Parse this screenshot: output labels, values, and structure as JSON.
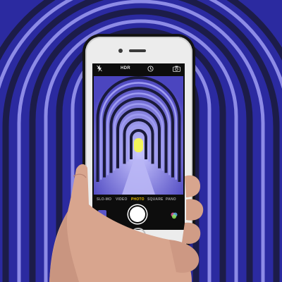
{
  "camera_ui": {
    "hdr_label": "HDR",
    "modes": [
      {
        "label": "SLO-MO"
      },
      {
        "label": "VIDEO"
      },
      {
        "label": "PHOTO"
      },
      {
        "label": "SQUARE"
      },
      {
        "label": "PANO"
      }
    ],
    "active_mode": "PHOTO"
  },
  "icons": {
    "flash": "flash-off-icon",
    "timer": "timer-icon",
    "flip": "camera-flip-icon",
    "filters": "filters-icon"
  },
  "colors": {
    "background": "#2b2aa0",
    "tunnel_light": "#9f9cf2",
    "tunnel_dark": "#1a1a3a",
    "active_mode": "#f2c100",
    "end_glow": "#f4f55a"
  }
}
